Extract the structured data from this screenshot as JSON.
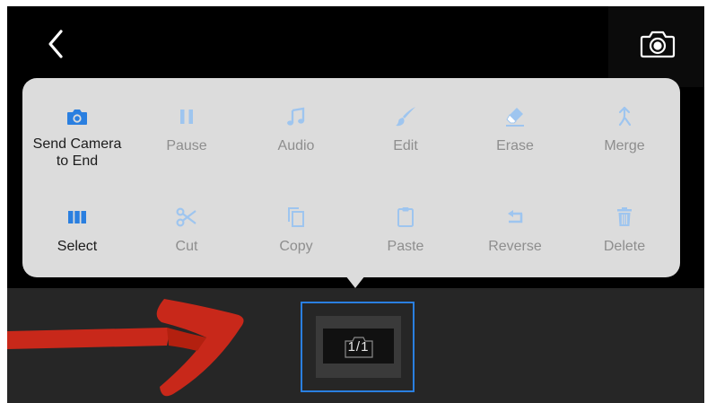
{
  "menu": {
    "row1": [
      {
        "label": "Send Camera\nto End",
        "icon": "camera-icon",
        "active": true
      },
      {
        "label": "Pause",
        "icon": "pause-icon",
        "active": false
      },
      {
        "label": "Audio",
        "icon": "music-note-icon",
        "active": false
      },
      {
        "label": "Edit",
        "icon": "brush-icon",
        "active": false
      },
      {
        "label": "Erase",
        "icon": "eraser-icon",
        "active": false
      },
      {
        "label": "Merge",
        "icon": "merge-icon",
        "active": false
      }
    ],
    "row2": [
      {
        "label": "Select",
        "icon": "columns-icon",
        "active": true
      },
      {
        "label": "Cut",
        "icon": "scissors-icon",
        "active": false
      },
      {
        "label": "Copy",
        "icon": "copy-icon",
        "active": false
      },
      {
        "label": "Paste",
        "icon": "clipboard-icon",
        "active": false
      },
      {
        "label": "Reverse",
        "icon": "reverse-icon",
        "active": false
      },
      {
        "label": "Delete",
        "icon": "trash-icon",
        "active": false
      }
    ]
  },
  "clip": {
    "label": "1/1"
  },
  "colors": {
    "accent": "#2a7fe0",
    "active_text": "#1c1c1c",
    "inactive_text": "#8e8e8e",
    "arrow_red": "#c8281a"
  }
}
